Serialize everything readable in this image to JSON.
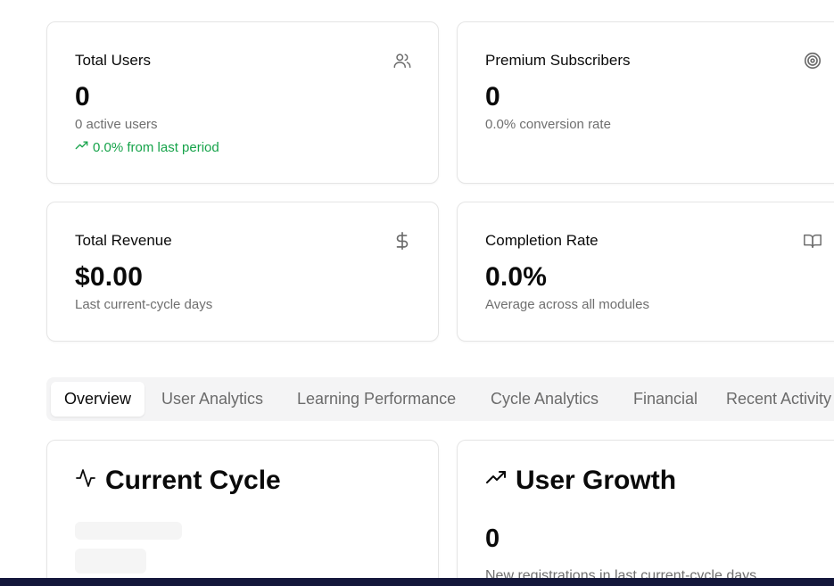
{
  "stats": {
    "total_users": {
      "title": "Total Users",
      "icon": "users-icon",
      "value": "0",
      "subtitle": "0 active users",
      "trend": "0.0% from last period"
    },
    "premium": {
      "title": "Premium Subscribers",
      "icon": "target-icon",
      "value": "0",
      "subtitle": "0.0% conversion rate"
    },
    "revenue": {
      "title": "Total Revenue",
      "icon": "dollar-icon",
      "value": "$0.00",
      "subtitle": "Last current-cycle days"
    },
    "completion": {
      "title": "Completion Rate",
      "icon": "book-open-icon",
      "value": "0.0%",
      "subtitle": "Average across all modules"
    }
  },
  "tabs": [
    {
      "label": "Overview",
      "active": true
    },
    {
      "label": "User Analytics",
      "active": false
    },
    {
      "label": "Learning Performance",
      "active": false
    },
    {
      "label": "Cycle Analytics",
      "active": false
    },
    {
      "label": "Financial",
      "active": false
    },
    {
      "label": "Recent Activity",
      "active": false
    }
  ],
  "panels": {
    "current_cycle": {
      "title": "Current Cycle",
      "icon": "activity-icon"
    },
    "user_growth": {
      "title": "User Growth",
      "icon": "trending-up-icon",
      "value": "0",
      "subtitle": "New registrations in last current-cycle days"
    }
  },
  "colors": {
    "positive": "#16a34a",
    "muted_text": "#6f6f6f",
    "tab_bg": "#f4f4f5",
    "bottom_bar": "#14173b"
  }
}
